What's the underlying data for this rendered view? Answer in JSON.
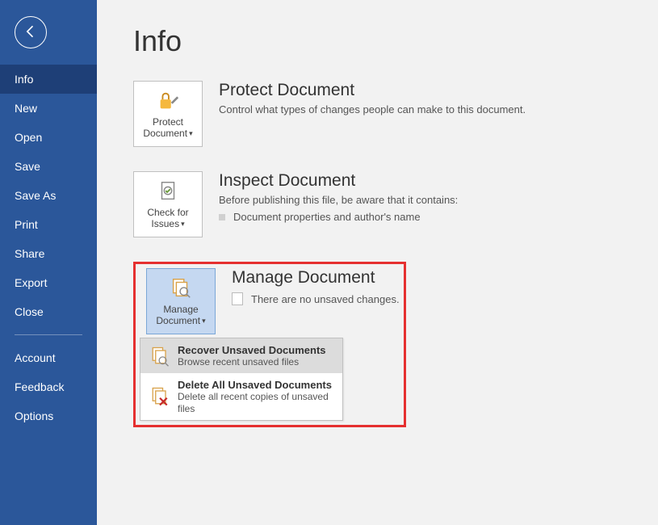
{
  "sidebar": {
    "items": [
      {
        "label": "Info",
        "active": true
      },
      {
        "label": "New"
      },
      {
        "label": "Open"
      },
      {
        "label": "Save"
      },
      {
        "label": "Save As"
      },
      {
        "label": "Print"
      },
      {
        "label": "Share"
      },
      {
        "label": "Export"
      },
      {
        "label": "Close"
      }
    ],
    "footer": [
      {
        "label": "Account"
      },
      {
        "label": "Feedback"
      },
      {
        "label": "Options"
      }
    ]
  },
  "page": {
    "title": "Info"
  },
  "protect": {
    "tile_label": "Protect Document",
    "heading": "Protect Document",
    "desc": "Control what types of changes people can make to this document."
  },
  "inspect": {
    "tile_label": "Check for Issues",
    "heading": "Inspect Document",
    "desc": "Before publishing this file, be aware that it contains:",
    "bullet": "Document properties and author's name"
  },
  "manage": {
    "tile_label": "Manage Document",
    "heading": "Manage Document",
    "status": "There are no unsaved changes.",
    "menu": [
      {
        "title": "Recover Unsaved Documents",
        "desc": "Browse recent unsaved files"
      },
      {
        "title": "Delete All Unsaved Documents",
        "desc": "Delete all recent copies of unsaved files"
      }
    ]
  }
}
